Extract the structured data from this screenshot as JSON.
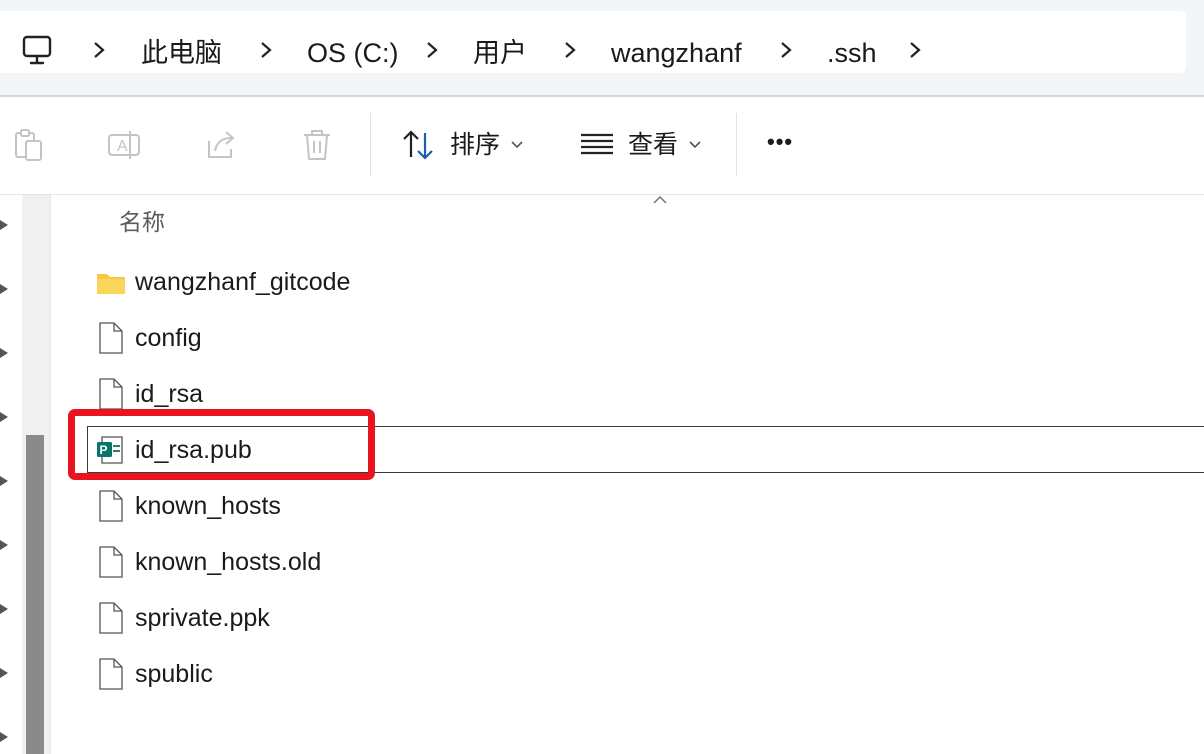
{
  "breadcrumb": {
    "items": [
      "此电脑",
      "OS (C:)",
      "用户",
      "wangzhanf",
      ".ssh"
    ]
  },
  "toolbar": {
    "sort_label": "排序",
    "view_label": "查看",
    "more_label": "•••"
  },
  "file_list": {
    "column_name": "名称",
    "sort_direction": "ascending",
    "items": [
      {
        "name": "wangzhanf_gitcode",
        "type": "folder"
      },
      {
        "name": "config",
        "type": "file"
      },
      {
        "name": "id_rsa",
        "type": "file"
      },
      {
        "name": "id_rsa.pub",
        "type": "publisher-file",
        "selected": true,
        "highlighted": true
      },
      {
        "name": "known_hosts",
        "type": "file"
      },
      {
        "name": "known_hosts.old",
        "type": "file"
      },
      {
        "name": "sprivate.ppk",
        "type": "file"
      },
      {
        "name": "spublic",
        "type": "file"
      }
    ]
  },
  "colors": {
    "highlight_box": "#e8141f",
    "folder": "#f7c844",
    "publisher_icon": "#077568",
    "toolbar_icon_blue": "#1a5fb4"
  }
}
